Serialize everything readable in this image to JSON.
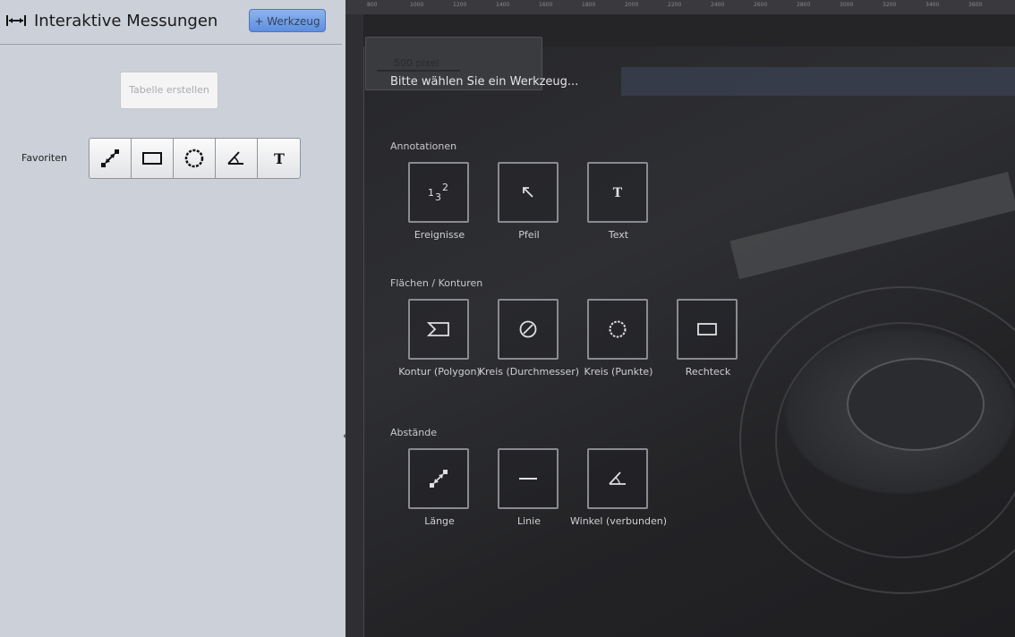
{
  "panel": {
    "title": "Interaktive Messungen",
    "title_icon": "horizontal-measure-icon",
    "add_tool_label": "+ Werkzeug",
    "table_button_label": "Tabelle erstellen",
    "favorites_label": "Favoriten",
    "favorites": [
      {
        "name": "length-icon"
      },
      {
        "name": "rectangle-icon"
      },
      {
        "name": "circle-points-icon"
      },
      {
        "name": "angle-icon"
      },
      {
        "name": "text-icon"
      }
    ]
  },
  "canvas": {
    "scale_label": "500 pixel",
    "ruler_ticks": [
      "800",
      "1000",
      "1200",
      "1400",
      "1600",
      "1800",
      "2000",
      "2200",
      "2400",
      "2600",
      "2800",
      "3000",
      "3200",
      "3400",
      "3600"
    ],
    "prompt": "Bitte wählen Sie ein Werkzeug...",
    "sections": [
      {
        "label": "Annotationen",
        "tools": [
          {
            "label": "Ereignisse",
            "icon": "event-counter-icon"
          },
          {
            "label": "Pfeil",
            "icon": "arrow-icon"
          },
          {
            "label": "Text",
            "icon": "text-icon"
          }
        ]
      },
      {
        "label": "Flächen / Konturen",
        "tools": [
          {
            "label": "Kontur (Polygon)",
            "icon": "polygon-icon"
          },
          {
            "label": "Kreis (Durchmesser)",
            "icon": "circle-diameter-icon"
          },
          {
            "label": "Kreis (Punkte)",
            "icon": "circle-points-icon"
          },
          {
            "label": "Rechteck",
            "icon": "rectangle-icon"
          }
        ]
      },
      {
        "label": "Abstände",
        "tools": [
          {
            "label": "Länge",
            "icon": "length-icon"
          },
          {
            "label": "Linie",
            "icon": "line-icon"
          },
          {
            "label": "Winkel (verbunden)",
            "icon": "angle-icon"
          }
        ]
      }
    ]
  }
}
